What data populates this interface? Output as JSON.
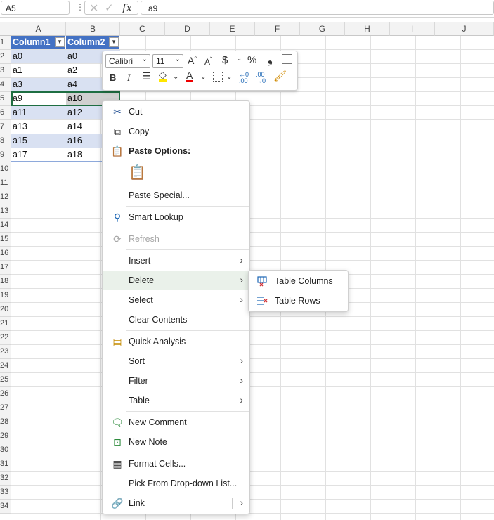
{
  "formula_bar": {
    "name_box": "A5",
    "formula": "a9",
    "fx": "fx"
  },
  "columns": [
    "A",
    "B",
    "C",
    "D",
    "E",
    "F",
    "G",
    "H",
    "I",
    "J"
  ],
  "rows": [
    "1",
    "2",
    "3",
    "4",
    "5",
    "6",
    "7",
    "8",
    "9",
    "10",
    "11",
    "12",
    "13",
    "14",
    "15",
    "16",
    "17",
    "18",
    "19",
    "20",
    "21",
    "22",
    "23",
    "24",
    "25",
    "26",
    "27",
    "28",
    "29",
    "30",
    "31",
    "32",
    "33",
    "34"
  ],
  "table": {
    "headers": [
      "Column1",
      "Column2"
    ],
    "rows": [
      [
        "a0",
        "a0"
      ],
      [
        "a1",
        "a2"
      ],
      [
        "a3",
        "a4"
      ],
      [
        "a9",
        "a10"
      ],
      [
        "a11",
        "a12"
      ],
      [
        "a13",
        "a14"
      ],
      [
        "a15",
        "a16"
      ],
      [
        "a17",
        "a18"
      ]
    ]
  },
  "mini_toolbar": {
    "font": "Calibri",
    "size": "11",
    "bold": "B",
    "italic": "I",
    "percent": "%",
    "comma": "❟"
  },
  "context_menu": {
    "cut": "Cut",
    "copy": "Copy",
    "paste_options": "Paste Options:",
    "paste_special": "Paste Special...",
    "smart_lookup": "Smart Lookup",
    "refresh": "Refresh",
    "insert": "Insert",
    "delete": "Delete",
    "select": "Select",
    "clear_contents": "Clear Contents",
    "quick_analysis": "Quick Analysis",
    "sort": "Sort",
    "filter": "Filter",
    "table": "Table",
    "new_comment": "New Comment",
    "new_note": "New Note",
    "format_cells": "Format Cells...",
    "pick_from_dropdown": "Pick From Drop-down List...",
    "link": "Link"
  },
  "delete_submenu": {
    "table_columns": "Table Columns",
    "table_rows": "Table Rows"
  },
  "colors": {
    "table_header": "#4472c4",
    "band": "#d9e1f2",
    "selection": "#1e6e42",
    "highlight": "#eaf1ea"
  }
}
